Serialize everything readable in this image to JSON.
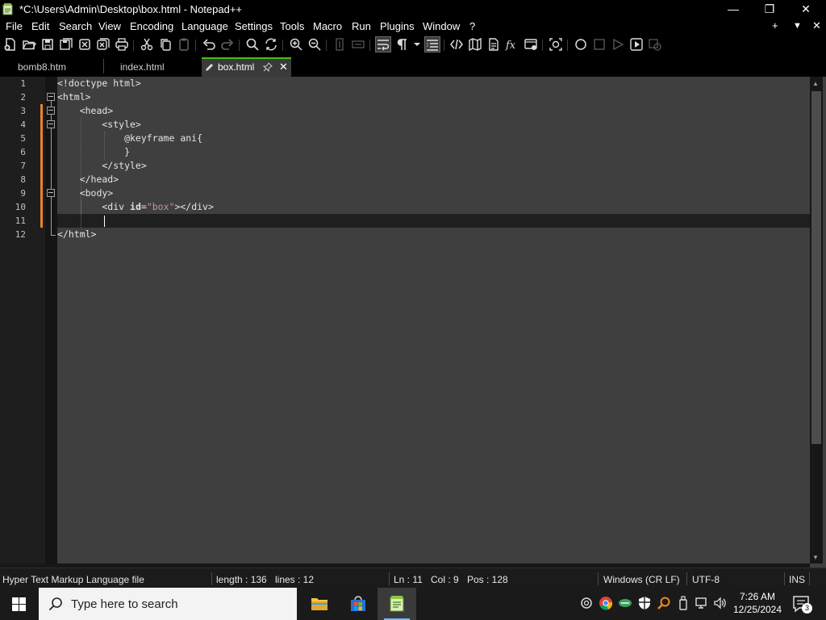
{
  "window": {
    "title": "*C:\\Users\\Admin\\Desktop\\box.html - Notepad++",
    "minimize": "—",
    "restore": "❐",
    "close": "✕"
  },
  "menu": {
    "items": [
      "File",
      "Edit",
      "Search",
      "View",
      "Encoding",
      "Language",
      "Settings",
      "Tools",
      "Macro",
      "Run",
      "Plugins",
      "Window",
      "?"
    ],
    "right": [
      "+",
      "▼",
      "✕"
    ]
  },
  "tabs": [
    {
      "label": "bomb8.htm",
      "active": false
    },
    {
      "label": "index.html",
      "active": false
    },
    {
      "label": "box.html",
      "active": true
    }
  ],
  "editor": {
    "line_numbers": [
      "1",
      "2",
      "3",
      "4",
      "5",
      "6",
      "7",
      "8",
      "9",
      "10",
      "11",
      "12"
    ],
    "current_line": 11
  },
  "status": {
    "file_type": "Hyper Text Markup Language file",
    "length": "length : 136",
    "lines": "lines : 12",
    "ln": "Ln : 11",
    "col": "Col : 9",
    "pos": "Pos : 128",
    "eol": "Windows (CR LF)",
    "encoding": "UTF-8",
    "mode": "INS"
  },
  "taskbar": {
    "search_placeholder": "Type here to search",
    "time": "7:26 AM",
    "date": "12/25/2024",
    "notification_count": "3"
  },
  "colors": {
    "accent_tab": "#4cbb17",
    "change_marker": "#e8832b",
    "editor_bg": "#3f3f3f",
    "attr_value": "#cc9393"
  }
}
